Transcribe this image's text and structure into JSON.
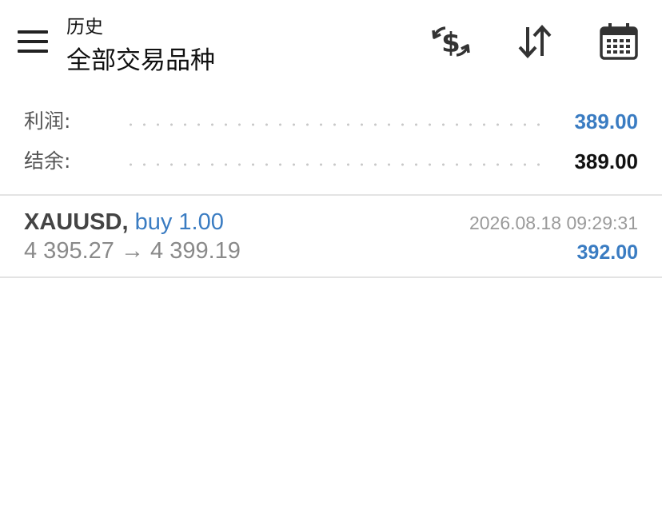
{
  "header": {
    "title": "历史",
    "subtitle": "全部交易品种",
    "icons": [
      "menu-icon",
      "currency-exchange-icon",
      "sort-icon",
      "calendar-icon"
    ]
  },
  "summary": {
    "profit_label": "利润:",
    "profit_value": "389.00",
    "balance_label": "结余:",
    "balance_value": "389.00"
  },
  "deals": [
    {
      "symbol": "XAUUSD,",
      "side": "buy 1.00",
      "open_price": "4 395.27",
      "arrow": "→",
      "close_price": "4 399.19",
      "time": "2026.08.18 09:29:31",
      "profit": "392.00"
    }
  ],
  "colors": {
    "accent": "#3a7cc2",
    "text": "#222222",
    "muted": "#8a8a8a",
    "divider": "#e3e3e3"
  }
}
